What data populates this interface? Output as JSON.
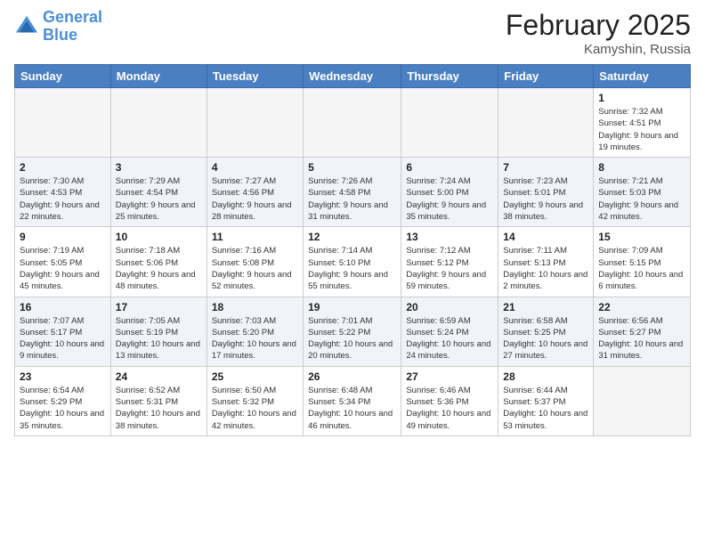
{
  "header": {
    "logo_line1": "General",
    "logo_line2": "Blue",
    "month_year": "February 2025",
    "location": "Kamyshin, Russia"
  },
  "weekdays": [
    "Sunday",
    "Monday",
    "Tuesday",
    "Wednesday",
    "Thursday",
    "Friday",
    "Saturday"
  ],
  "weeks": [
    [
      {
        "day": "",
        "info": ""
      },
      {
        "day": "",
        "info": ""
      },
      {
        "day": "",
        "info": ""
      },
      {
        "day": "",
        "info": ""
      },
      {
        "day": "",
        "info": ""
      },
      {
        "day": "",
        "info": ""
      },
      {
        "day": "1",
        "info": "Sunrise: 7:32 AM\nSunset: 4:51 PM\nDaylight: 9 hours and 19 minutes."
      }
    ],
    [
      {
        "day": "2",
        "info": "Sunrise: 7:30 AM\nSunset: 4:53 PM\nDaylight: 9 hours and 22 minutes."
      },
      {
        "day": "3",
        "info": "Sunrise: 7:29 AM\nSunset: 4:54 PM\nDaylight: 9 hours and 25 minutes."
      },
      {
        "day": "4",
        "info": "Sunrise: 7:27 AM\nSunset: 4:56 PM\nDaylight: 9 hours and 28 minutes."
      },
      {
        "day": "5",
        "info": "Sunrise: 7:26 AM\nSunset: 4:58 PM\nDaylight: 9 hours and 31 minutes."
      },
      {
        "day": "6",
        "info": "Sunrise: 7:24 AM\nSunset: 5:00 PM\nDaylight: 9 hours and 35 minutes."
      },
      {
        "day": "7",
        "info": "Sunrise: 7:23 AM\nSunset: 5:01 PM\nDaylight: 9 hours and 38 minutes."
      },
      {
        "day": "8",
        "info": "Sunrise: 7:21 AM\nSunset: 5:03 PM\nDaylight: 9 hours and 42 minutes."
      }
    ],
    [
      {
        "day": "9",
        "info": "Sunrise: 7:19 AM\nSunset: 5:05 PM\nDaylight: 9 hours and 45 minutes."
      },
      {
        "day": "10",
        "info": "Sunrise: 7:18 AM\nSunset: 5:06 PM\nDaylight: 9 hours and 48 minutes."
      },
      {
        "day": "11",
        "info": "Sunrise: 7:16 AM\nSunset: 5:08 PM\nDaylight: 9 hours and 52 minutes."
      },
      {
        "day": "12",
        "info": "Sunrise: 7:14 AM\nSunset: 5:10 PM\nDaylight: 9 hours and 55 minutes."
      },
      {
        "day": "13",
        "info": "Sunrise: 7:12 AM\nSunset: 5:12 PM\nDaylight: 9 hours and 59 minutes."
      },
      {
        "day": "14",
        "info": "Sunrise: 7:11 AM\nSunset: 5:13 PM\nDaylight: 10 hours and 2 minutes."
      },
      {
        "day": "15",
        "info": "Sunrise: 7:09 AM\nSunset: 5:15 PM\nDaylight: 10 hours and 6 minutes."
      }
    ],
    [
      {
        "day": "16",
        "info": "Sunrise: 7:07 AM\nSunset: 5:17 PM\nDaylight: 10 hours and 9 minutes."
      },
      {
        "day": "17",
        "info": "Sunrise: 7:05 AM\nSunset: 5:19 PM\nDaylight: 10 hours and 13 minutes."
      },
      {
        "day": "18",
        "info": "Sunrise: 7:03 AM\nSunset: 5:20 PM\nDaylight: 10 hours and 17 minutes."
      },
      {
        "day": "19",
        "info": "Sunrise: 7:01 AM\nSunset: 5:22 PM\nDaylight: 10 hours and 20 minutes."
      },
      {
        "day": "20",
        "info": "Sunrise: 6:59 AM\nSunset: 5:24 PM\nDaylight: 10 hours and 24 minutes."
      },
      {
        "day": "21",
        "info": "Sunrise: 6:58 AM\nSunset: 5:25 PM\nDaylight: 10 hours and 27 minutes."
      },
      {
        "day": "22",
        "info": "Sunrise: 6:56 AM\nSunset: 5:27 PM\nDaylight: 10 hours and 31 minutes."
      }
    ],
    [
      {
        "day": "23",
        "info": "Sunrise: 6:54 AM\nSunset: 5:29 PM\nDaylight: 10 hours and 35 minutes."
      },
      {
        "day": "24",
        "info": "Sunrise: 6:52 AM\nSunset: 5:31 PM\nDaylight: 10 hours and 38 minutes."
      },
      {
        "day": "25",
        "info": "Sunrise: 6:50 AM\nSunset: 5:32 PM\nDaylight: 10 hours and 42 minutes."
      },
      {
        "day": "26",
        "info": "Sunrise: 6:48 AM\nSunset: 5:34 PM\nDaylight: 10 hours and 46 minutes."
      },
      {
        "day": "27",
        "info": "Sunrise: 6:46 AM\nSunset: 5:36 PM\nDaylight: 10 hours and 49 minutes."
      },
      {
        "day": "28",
        "info": "Sunrise: 6:44 AM\nSunset: 5:37 PM\nDaylight: 10 hours and 53 minutes."
      },
      {
        "day": "",
        "info": ""
      }
    ]
  ]
}
